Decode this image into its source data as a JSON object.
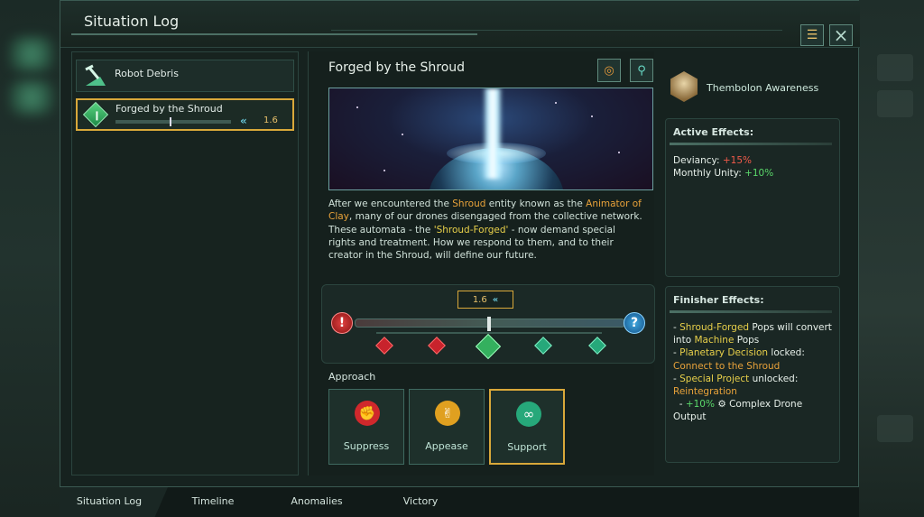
{
  "window": {
    "title": "Situation Log",
    "locate_icon": "map-pin-list-icon",
    "close_icon": "close-icon"
  },
  "log_items": [
    {
      "label": "Robot Debris",
      "icon": "pickaxe-icon"
    },
    {
      "label": "Forged by the Shroud",
      "icon": "situation-diamond-icon",
      "progress_value": "1.6"
    }
  ],
  "situation": {
    "title": "Forged by the Shroud",
    "description": {
      "p1": "After we encountered the ",
      "shroud": "Shroud",
      "p2": " entity known as the ",
      "animator": "Animator of Clay",
      "p3": ", many of our drones disengaged from the collective network. These automata - the ",
      "forged": "'Shroud-Forged'",
      "p4": " - now demand special rights and treatment. How we respond to them, and to their creator in the Shroud, will define our future."
    },
    "slider_value": "1.6",
    "approach_label": "Approach",
    "approaches": [
      {
        "label": "Suppress",
        "color": "#d0282c",
        "icon": "fist-icon"
      },
      {
        "label": "Appease",
        "color": "#e0a020",
        "icon": "handshake-icon"
      },
      {
        "label": "Support",
        "color": "#26a87a",
        "icon": "support-knot-icon"
      }
    ]
  },
  "species": {
    "name": "Thembolon Awareness"
  },
  "active_effects": {
    "title": "Active Effects:",
    "deviancy_label": "Deviancy: ",
    "deviancy_value": "+15%",
    "unity_label": "Monthly Unity: ",
    "unity_value": "+10%"
  },
  "finisher": {
    "title": "Finisher Effects:",
    "l1a": "- ",
    "l1b": "Shroud-Forged",
    "l1c": " Pops will convert into ",
    "l1d": "Machine",
    "l1e": " Pops",
    "l2a": "- ",
    "l2b": "Planetary Decision",
    "l2c": " locked:",
    "l3": "Connect to the Shroud",
    "l4a": "- ",
    "l4b": "Special Project",
    "l4c": " unlocked:",
    "l5": "Reintegration",
    "l6a": "- ",
    "l6b": "+10%",
    "l6c": " Complex Drone Output"
  },
  "tabs": [
    "Situation Log",
    "Timeline",
    "Anomalies",
    "Victory"
  ]
}
